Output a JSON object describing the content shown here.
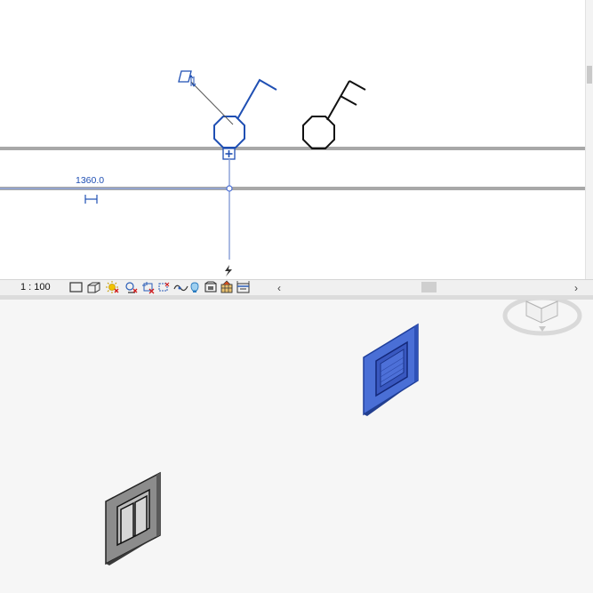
{
  "plan_view": {
    "dimension_value": "1360.0"
  },
  "view_control_bar": {
    "scale": "1 : 100",
    "icons": [
      "detail-level-icon",
      "visual-style-icon",
      "sun-path-icon",
      "shadows-icon",
      "crop-view-icon",
      "show-crop-region-icon",
      "unlock-3d-view-icon",
      "temporary-isolate-icon",
      "reveal-hidden-icon",
      "worksharing-display-icon",
      "temporary-view-properties-icon",
      "highlight-displacement-icon"
    ],
    "scroll_left": "‹",
    "scroll_right": "›"
  },
  "view_3d": {
    "selected_element_color": "#4a6fd6",
    "switch_color": "#8c8c8c"
  },
  "colors": {
    "selection_blue": "#1f4fb3",
    "wall_gray": "#a8a8a8",
    "background": "#ffffff"
  }
}
